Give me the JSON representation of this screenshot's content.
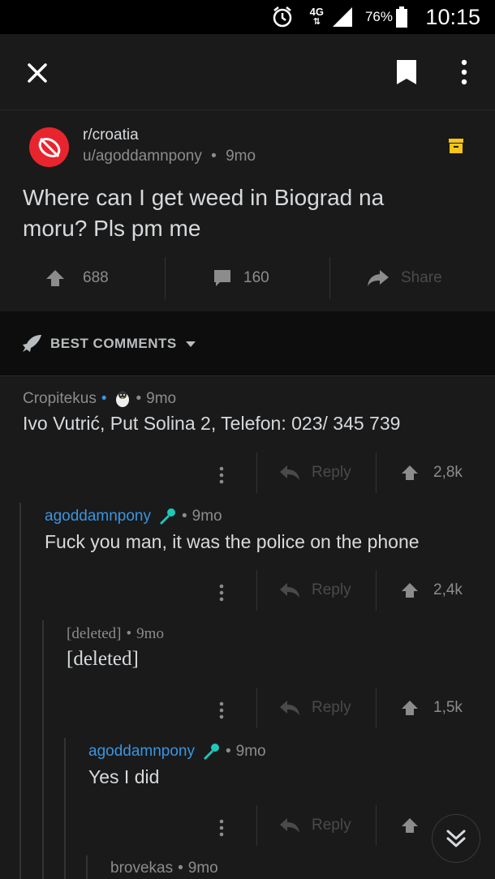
{
  "status_bar": {
    "time": "10:15",
    "battery": "76%",
    "network": "4G",
    "icons": [
      "alarm-icon",
      "data-arrows-icon",
      "signal-icon",
      "battery-icon"
    ]
  },
  "top_bar": {
    "icons": [
      "close-icon",
      "bookmark-icon",
      "more-vertical-icon"
    ]
  },
  "post": {
    "subreddit": "r/croatia",
    "author": "u/agoddamnpony",
    "age": "9mo",
    "title_line1": "Where can I get weed in Biograd na",
    "title_line2": "moru? Pls pm me",
    "upvotes": "688",
    "comments": "160",
    "share_label": "Share"
  },
  "sort": {
    "label": "BEST COMMENTS"
  },
  "comments": [
    {
      "author": "Cropitekus",
      "age": "9mo",
      "body": "Ivo Vutrić, Put Solina 2, Telefon: 023/ 345 739",
      "reply_label": "Reply",
      "score": "2,8k",
      "flair_icon": "penguin-icon"
    },
    {
      "author": "agoddamnpony",
      "age": "9mo",
      "body": "Fuck you man, it was the police on the phone",
      "reply_label": "Reply",
      "score": "2,4k",
      "flair_icon": "microphone-icon"
    },
    {
      "author": "[deleted]",
      "age": "9mo",
      "body": "[deleted]",
      "reply_label": "Reply",
      "score": "1,5k"
    },
    {
      "author": "agoddamnpony",
      "age": "9mo",
      "body": "Yes I did",
      "reply_label": "Reply",
      "flair_icon": "microphone-icon"
    },
    {
      "author": "brovekas",
      "age": "9mo"
    }
  ],
  "colors": {
    "background": "#1a1a1b",
    "op_blue": "#3a95e0",
    "subreddit_red": "#e8252f",
    "archive_yellow": "#f5c518",
    "flair_teal": "#1fc7b8"
  }
}
